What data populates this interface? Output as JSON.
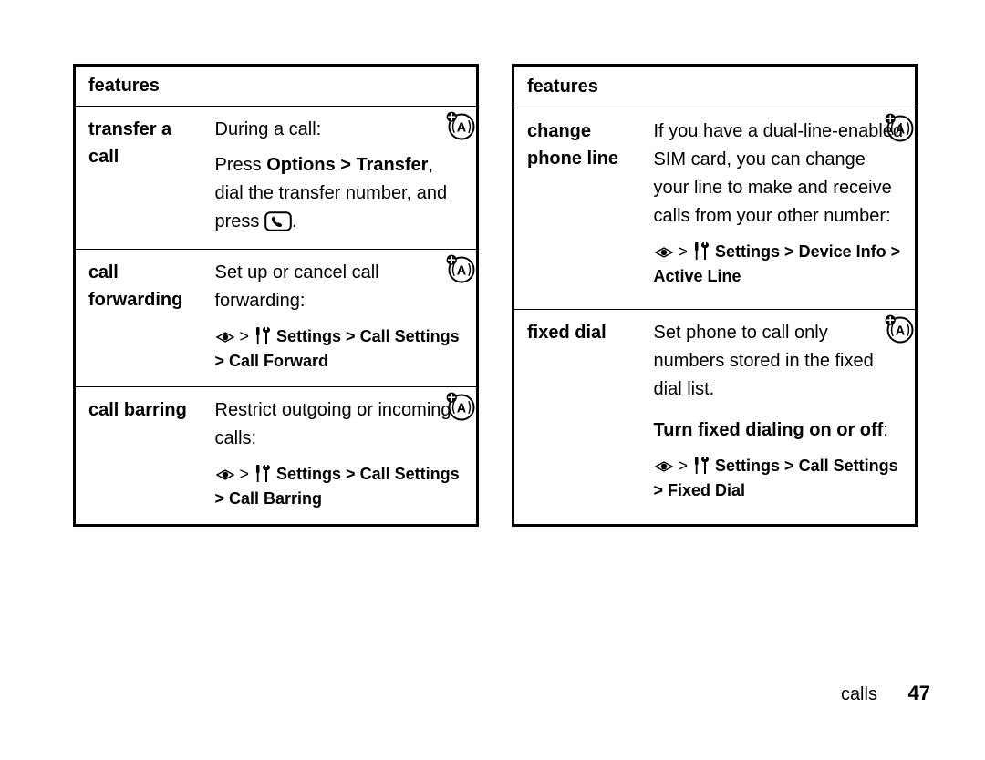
{
  "tables": [
    {
      "header": "features",
      "rows": [
        {
          "label": "transfer a call",
          "desc_parts": [
            "During a call:"
          ],
          "instruction_prefix": "Press ",
          "instruction_cond": "Options > Transfer",
          "instruction_mid": ", dial the transfer number, and press ",
          "instruction_has_send": true,
          "instruction_suffix": ".",
          "has_sim_icon": true
        },
        {
          "label": "call forwarding",
          "desc_parts": [
            "Set up or cancel call forwarding:"
          ],
          "path": "Settings > Call Settings > Call Forward",
          "has_sim_icon": true
        },
        {
          "label": "call barring",
          "desc_parts": [
            "Restrict outgoing or incoming calls:"
          ],
          "path": "Settings > Call Settings > Call Barring",
          "has_sim_icon": true
        }
      ]
    },
    {
      "header": "features",
      "rows": [
        {
          "label": "change phone line",
          "desc_parts": [
            "If you have a dual-line-enabled SIM card, you can change your line to make and receive calls from your other number:"
          ],
          "path": "Settings > Device Info > Active Line",
          "has_sim_icon": true
        },
        {
          "label": "fixed dial",
          "desc_parts": [
            "Set phone to call only numbers stored in the fixed dial list."
          ],
          "sub_bold": "Turn fixed dialing on or off",
          "sub_bold_suffix": ":",
          "path": "Settings > Call Settings > Fixed Dial",
          "has_sim_icon": true
        }
      ]
    }
  ],
  "footer": {
    "section": "calls",
    "page": "47"
  }
}
